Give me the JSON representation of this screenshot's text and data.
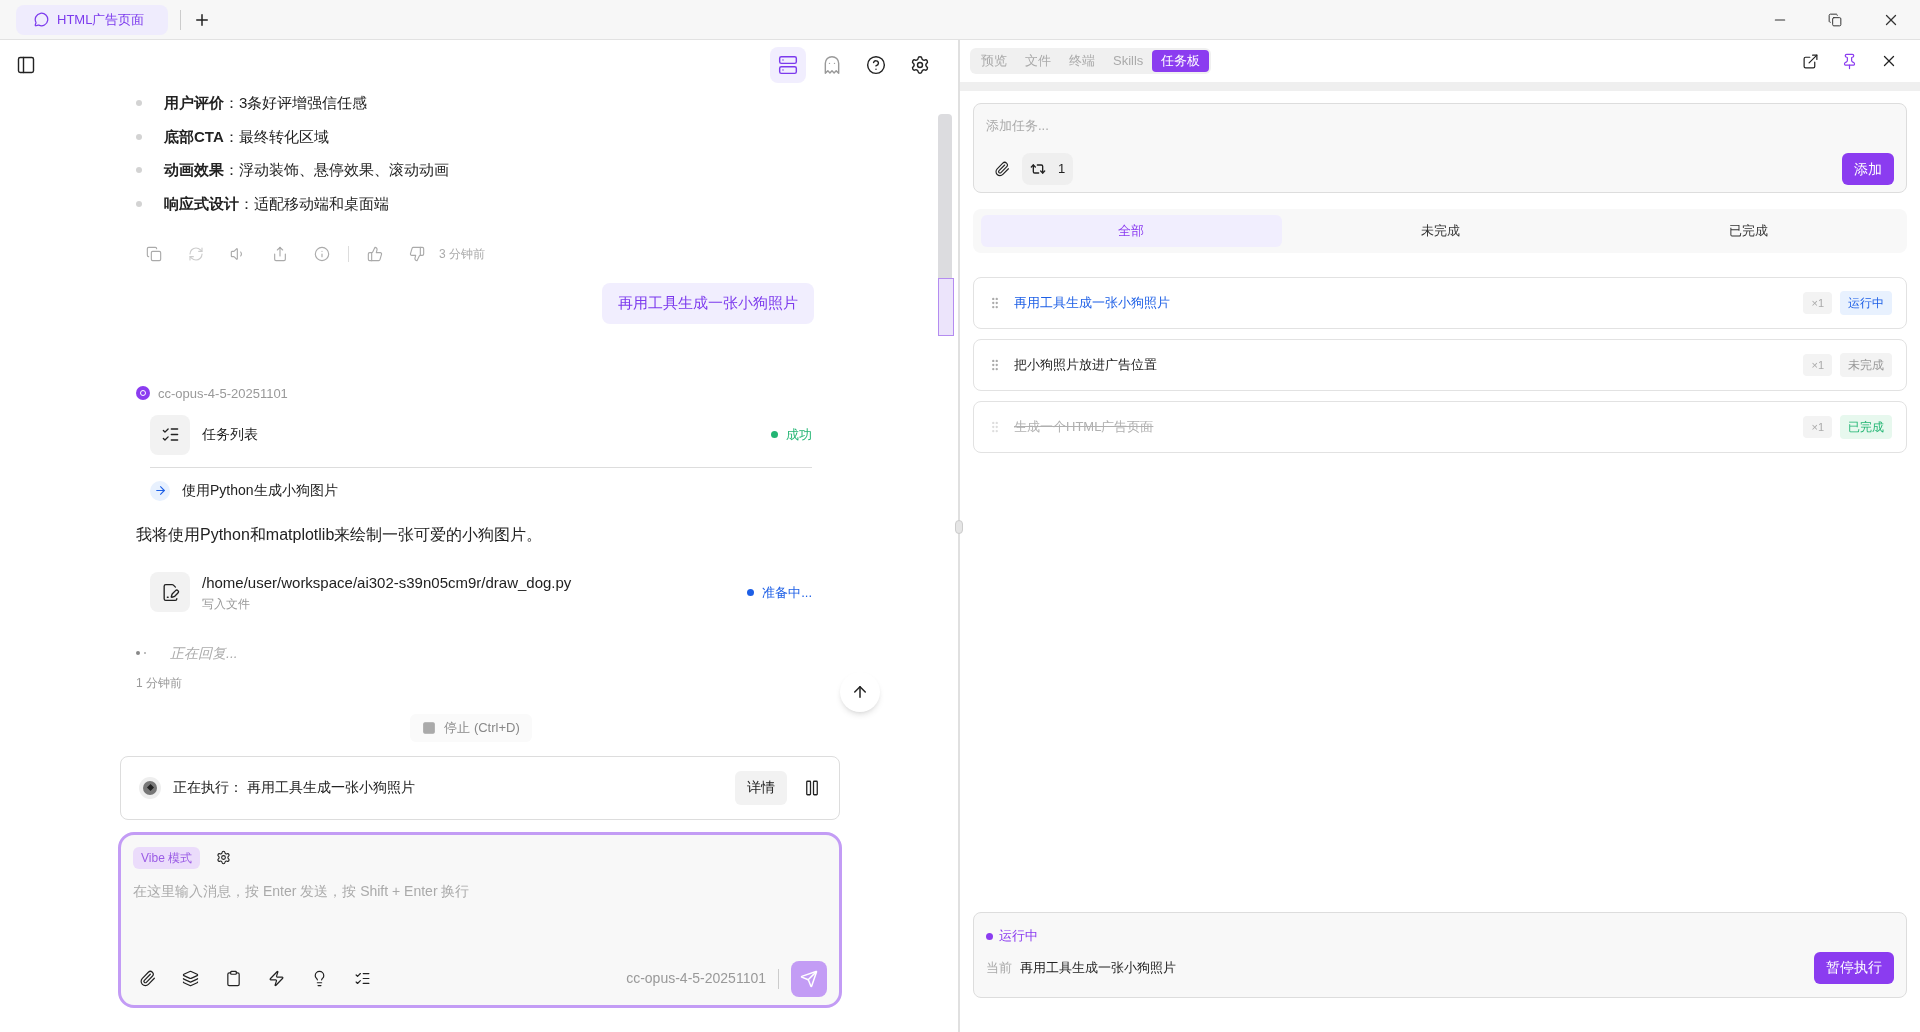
{
  "app_tabs": [
    {
      "label": "HTML广告页面",
      "selected": true
    }
  ],
  "chat": {
    "bullets": [
      "**用户评价**：3条好评增强信任感",
      "**底部CTA**：最终转化区域",
      "**动画效果**：浮动装饰、悬停效果、滚动动画",
      "**响应式设计**：适配移动端和桌面端"
    ],
    "message_time": "3 分钟前",
    "user_message": "再用工具生成一张小狗照片",
    "model_name": "cc-opus-4-5-20251101",
    "task_tool": {
      "title": "任务列表",
      "status": "成功",
      "kind": "success"
    },
    "sub_step": "使用Python生成小狗图片",
    "paragraph": "我将使用Python和matplotlib来绘制一张可爱的小狗图片。",
    "file_tool": {
      "path": "/home/user/workspace/ai302-s39n05cm9r/draw_dog.py",
      "subtitle": "写入文件",
      "status": "准备中...",
      "kind": "pending"
    },
    "replying": "正在回复...",
    "reply_time": "1 分钟前",
    "stop_button": "停止 (Ctrl+D)",
    "executing": {
      "label": "正在执行：",
      "task": "再用工具生成一张小狗照片",
      "details_button": "详情"
    },
    "composer": {
      "mode_badge": "Vibe 模式",
      "placeholder": "在这里输入消息，按 Enter 发送，按 Shift + Enter 换行",
      "model": "cc-opus-4-5-20251101"
    }
  },
  "panel": {
    "tabs": [
      {
        "label": "预览",
        "selected": false
      },
      {
        "label": "文件",
        "selected": false
      },
      {
        "label": "终端",
        "selected": false
      },
      {
        "label": "Skills",
        "selected": false
      },
      {
        "label": "任务板",
        "selected": true
      }
    ],
    "task_input": {
      "placeholder": "添加任务...",
      "repeat_count": "1",
      "add_button": "添加"
    },
    "filters": [
      {
        "label": "全部",
        "selected": true
      },
      {
        "label": "未完成",
        "selected": false
      },
      {
        "label": "已完成",
        "selected": false
      }
    ],
    "tasks": [
      {
        "title": "再用工具生成一张小狗照片",
        "count": "×1",
        "status": "运行中",
        "kind": "running"
      },
      {
        "title": "把小狗照片放进广告位置",
        "count": "×1",
        "status": "未完成",
        "kind": "todo"
      },
      {
        "title": "生成一个HTML广告页面",
        "count": "×1",
        "status": "已完成",
        "kind": "done"
      }
    ],
    "run_status": {
      "status": "运行中",
      "current_label": "当前",
      "current": "再用工具生成一张小狗照片",
      "pause_button": "暂停执行"
    }
  }
}
